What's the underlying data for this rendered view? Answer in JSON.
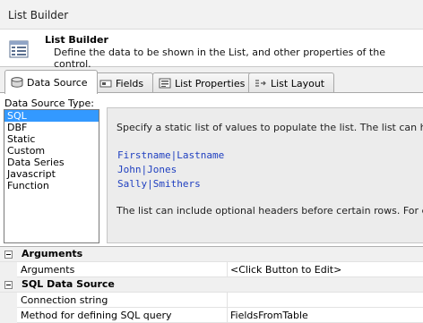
{
  "window": {
    "title": "List Builder"
  },
  "header": {
    "title": "List Builder",
    "description": "Define the data to be shown in the List, and other properties of the control."
  },
  "tabs": [
    {
      "label": "Data Source",
      "icon": "database-icon",
      "active": true
    },
    {
      "label": "Fields",
      "icon": "fields-icon",
      "active": false
    },
    {
      "label": "List Properties",
      "icon": "list-properties-icon",
      "active": false
    },
    {
      "label": "List Layout",
      "icon": "list-layout-icon",
      "active": false
    }
  ],
  "data_source": {
    "type_label": "Data Source Type:",
    "types": [
      "SQL",
      "DBF",
      "Static",
      "Custom",
      "Data Series",
      "Javascript Function"
    ],
    "selected": "SQL"
  },
  "help": {
    "intro": "Specify a static list of values to populate the list. The list can have one o",
    "code_lines": [
      "Firstname|Lastname",
      "John|Jones",
      "Sally|Smithers"
    ],
    "more": "The list can include optional headers before certain rows. For example:"
  },
  "properties": {
    "arguments_category": "Arguments",
    "arguments_name": "Arguments",
    "arguments_value": "<Click Button to Edit>",
    "sql_category": "SQL Data Source",
    "connection_name": "Connection string",
    "connection_value": "",
    "method_name": "Method for defining SQL query",
    "method_value": "FieldsFromTable"
  },
  "colors": {
    "selection": "#3399ff",
    "code_text": "#2040c0"
  }
}
